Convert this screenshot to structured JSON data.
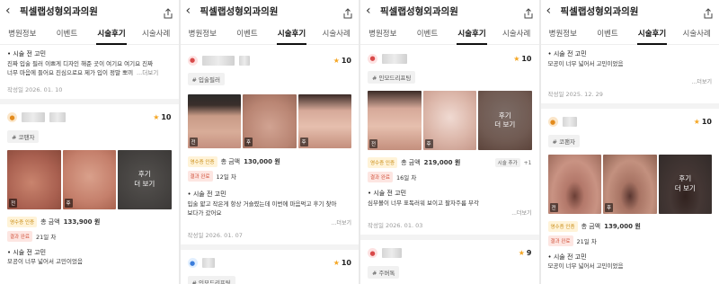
{
  "app": {
    "title": "픽셀랩성형외과의원",
    "tabs": [
      "병원정보",
      "이벤트",
      "시술후기",
      "시술사례"
    ],
    "active_tab": "시술후기",
    "accent": "#f5a623"
  },
  "labels": {
    "before": "전",
    "after": "후",
    "more_photos_1": "후기",
    "more_photos_2": "더 보기",
    "more_text": "...더보기",
    "cert": "영수증 인증",
    "result": "결과 완료",
    "total": "총 금액"
  },
  "screen1": {
    "top": {
      "line1": "• 시술 전 고민",
      "line2": "진짜 입술 필러 이쁘게 디자인 해준 곳이 여기요 여기요 진짜",
      "line3": "너무 마음에 들어요 진심으로요 제가 입이 정말 뽀끼",
      "more": "...더보기",
      "date": "작성일 2026. 01. 10"
    },
    "review": {
      "score": "10",
      "tag": "# 코팬자",
      "amount": "133,900 원",
      "days": "21일 차",
      "heading": "• 시술 전 고민",
      "body": "모공이 너무 넓어서 고민이었음"
    }
  },
  "screen2": {
    "review1": {
      "score": "10",
      "tag": "# 입술필러",
      "amount": "130,000 원",
      "days": "12일 차",
      "heading": "• 시술 전 고민",
      "body1": "입술 얇고 작은게 항상 거슬렸는데 이번에 마음먹고 후기 찾아",
      "body2": "보다가 갔어요",
      "more": "...더보기",
      "date": "작성일 2026. 01. 07"
    },
    "review2": {
      "score": "10",
      "tag": "# 인모드리프팅"
    }
  },
  "screen3": {
    "review1": {
      "score": "10",
      "tag": "# 인모드리프팅",
      "amount": "219,000 원",
      "extra_tag": "시술 추가",
      "extra_count": "+1",
      "days": "16일 차",
      "heading": "• 시술 전 고민",
      "body": "심부볼이 너무 표독러워 보이고 팔자주름 부각",
      "more": "...더보기",
      "date": "작성일 2026. 01. 03"
    },
    "review2": {
      "score": "9",
      "tag": "# 주버톡"
    }
  },
  "screen4": {
    "top": {
      "line1": "• 시술 전 고민",
      "line2": "모공이 너무 넓어서 고민이었음",
      "more": "...더보기",
      "date": "작성일 2025. 12. 29"
    },
    "review": {
      "score": "10",
      "tag": "# 코팬자",
      "amount": "139,000 원",
      "days": "21일 차",
      "heading": "• 시술 전 고민",
      "body": "모공이 너무 넓어서 고민이었음"
    }
  }
}
